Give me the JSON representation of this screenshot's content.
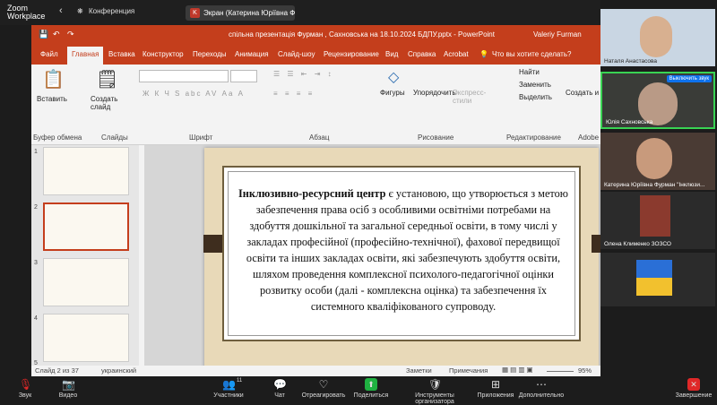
{
  "zoom": {
    "app_name_line1": "Zoom",
    "app_name_line2": "Workplace",
    "chevron": "‹",
    "conference_label": "Конференция",
    "share_tab_letter": "K",
    "share_tab_label": "Экран (Катерина Юріївна Фурм"
  },
  "ppt": {
    "title": "спільна презентація Фурман , Сахновська на 18.10.2024 БДПУ.pptx - PowerPoint",
    "user": "Valeriy Furman",
    "tabs": [
      "Файл",
      "Главная",
      "Вставка",
      "Конструктор",
      "Переходы",
      "Анимация",
      "Слайд-шоу",
      "Рецензирование",
      "Вид",
      "Справка",
      "Acrobat"
    ],
    "tell_me": "Что вы хотите сделать?",
    "ribbon": {
      "paste": "Вставить",
      "new_slide": "Создать слайд",
      "clipboard": "Буфер обмена",
      "slides": "Слайды",
      "font": "Шрифт",
      "paragraph": "Абзац",
      "shapes": "Фигуры",
      "arrange": "Упорядочить",
      "quick_styles": "Экспресс-стили",
      "drawing": "Рисование",
      "find": "Найти",
      "replace": "Заменить",
      "select": "Выделить",
      "editing": "Редактирование",
      "create_share": "Создать и",
      "adobe": "Adobe",
      "font_buttons": "Ж К Ч S abc AV Аа А"
    },
    "thumb_numbers": [
      "1",
      "2",
      "3",
      "4",
      "5"
    ],
    "slide_text_bold": "Інклюзивно-ресурсний центр",
    "slide_text_rest": " є установою, що утворюється з метою забезпечення права осіб з особливими освітніми потребами на здобуття дошкільної та загальної середньої освіти, в тому числі у закладах професійної (професійно-технічної), фахової передвищої освіти та інших закладах освіти, які забезпечують здобуття освіти, шляхом проведення комплексної психолого-педагогічної оцінки розвитку особи (далі - комплексна оцінка) та забезпечення їх системного кваліфікованого супроводу.",
    "status_slide": "Слайд 2 из 37",
    "status_lang": "украинский",
    "notes": "Заметки",
    "comments": "Примечания",
    "zoom_level": "95%"
  },
  "participants": [
    {
      "name": "Наталя Анастасова",
      "badge": ""
    },
    {
      "name": "Юлія Сахновська",
      "badge": "Выключить звук"
    },
    {
      "name": "Катерина Юріївна Фурман \"Інклюзи...",
      "badge": ""
    },
    {
      "name": "Олена Клименко ЗОЗСО",
      "badge": ""
    },
    {
      "name": "",
      "badge": ""
    }
  ],
  "toolbar": [
    {
      "label": "Звук",
      "icon": "mic-off-icon",
      "glyph": "🎙"
    },
    {
      "label": "Видео",
      "icon": "video-off-icon",
      "glyph": "📷"
    },
    {
      "label": "Участники",
      "icon": "participants-icon",
      "glyph": "👥",
      "count": "11"
    },
    {
      "label": "Чат",
      "icon": "chat-icon",
      "glyph": "💬"
    },
    {
      "label": "Отреагировать",
      "icon": "heart-icon",
      "glyph": "♡"
    },
    {
      "label": "Поделиться",
      "icon": "share-icon",
      "glyph": "⬆"
    },
    {
      "label": "Инструменты организатора",
      "icon": "shield-icon",
      "glyph": "🛡"
    },
    {
      "label": "Приложения",
      "icon": "apps-icon",
      "glyph": "⊞"
    },
    {
      "label": "Дополнительно",
      "icon": "more-icon",
      "glyph": "⋯"
    },
    {
      "label": "Завершение",
      "icon": "end-call-icon",
      "glyph": "✕"
    }
  ],
  "colors": {
    "ppt_accent": "#c43e1c",
    "share_green": "#1fb141",
    "end_red": "#e02828"
  }
}
